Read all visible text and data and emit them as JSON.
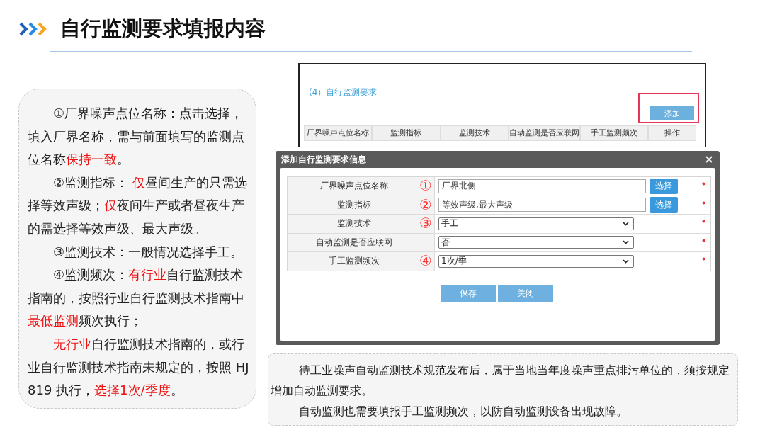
{
  "slide": {
    "title": "自行监测要求填报内容"
  },
  "explanation": {
    "paragraphs": [
      {
        "segments": [
          {
            "text": "①厂界噪声点位名称：点击选择，填入厂界名称，需与前面填写的监测点位名称",
            "highlight": false
          },
          {
            "text": "保持一致",
            "highlight": true
          },
          {
            "text": "。",
            "highlight": false
          }
        ]
      },
      {
        "segments": [
          {
            "text": "②监测指标： ",
            "highlight": false
          },
          {
            "text": "仅",
            "highlight": true
          },
          {
            "text": "昼间生产的只需选择等效声级；",
            "highlight": false
          },
          {
            "text": "仅",
            "highlight": true
          },
          {
            "text": "夜间生产或者昼夜生产的需选择等效声级、最大声级。",
            "highlight": false
          }
        ]
      },
      {
        "segments": [
          {
            "text": "③监测技术：一般情况选择手工。",
            "highlight": false
          }
        ]
      },
      {
        "segments": [
          {
            "text": "④监测频次：",
            "highlight": false
          },
          {
            "text": "有行业",
            "highlight": true
          },
          {
            "text": "自行监测技术指南的，按照行业自行监测技术指南中",
            "highlight": false
          },
          {
            "text": "最低监测",
            "highlight": true
          },
          {
            "text": "频次执行；",
            "highlight": false
          }
        ]
      },
      {
        "segments": [
          {
            "text": "无行业",
            "highlight": true
          },
          {
            "text": "自行监测技术指南的，或行业自行监测技术指南未规定的，按照 HJ 819 执行，",
            "highlight": false
          },
          {
            "text": "选择1次/季度",
            "highlight": true
          },
          {
            "text": "。",
            "highlight": false
          }
        ]
      }
    ]
  },
  "screenshot": {
    "section_title": "(4）自行监测要求",
    "add_button": {
      "label": "添加",
      "highlighted": true
    },
    "columns": [
      "厂界噪声点位名称",
      "监测指标",
      "监测技术",
      "自动监测是否应联网",
      "手工监测频次",
      "操作"
    ]
  },
  "dialog": {
    "title": "添加自行监测要求信息",
    "fields": [
      {
        "label": "厂界噪声点位名称",
        "marker": "①",
        "kind": "text",
        "value": "厂界北侧",
        "button": "选择",
        "required": true
      },
      {
        "label": "监测指标",
        "marker": "②",
        "kind": "text",
        "value": "等效声级,最大声级",
        "button": "选择",
        "required": true
      },
      {
        "label": "监测技术",
        "marker": "③",
        "kind": "select",
        "value": "手工",
        "required": true
      },
      {
        "label": "自动监测是否应联网",
        "kind": "select",
        "value": "否",
        "required": true
      },
      {
        "label": "手工监测频次",
        "marker": "④",
        "kind": "select",
        "value": "1次/季",
        "required": true
      }
    ],
    "buttons": [
      "保存",
      "关闭"
    ]
  },
  "note": {
    "paragraphs": [
      "待工业噪声自动监测技术规范发布后，属于当地当年度噪声重点排污单位的，须按规定增加自动监测要求。",
      "自动监测也需要填报手工监测频次，以防自动监测设备出现故障。"
    ]
  }
}
